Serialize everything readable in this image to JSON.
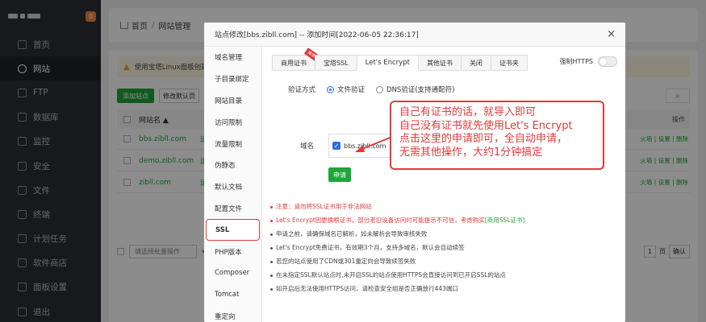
{
  "sidebar": {
    "badge": "0",
    "items": [
      {
        "label": "首页",
        "icon": "home-icon"
      },
      {
        "label": "网站",
        "icon": "globe-icon",
        "active": true
      },
      {
        "label": "FTP",
        "icon": "ftp-icon"
      },
      {
        "label": "数据库",
        "icon": "database-icon"
      },
      {
        "label": "监控",
        "icon": "monitor-icon"
      },
      {
        "label": "安全",
        "icon": "shield-icon"
      },
      {
        "label": "文件",
        "icon": "folder-icon"
      },
      {
        "label": "终端",
        "icon": "terminal-icon"
      },
      {
        "label": "计划任务",
        "icon": "calendar-icon"
      },
      {
        "label": "软件商店",
        "icon": "grid-icon"
      },
      {
        "label": "面板设置",
        "icon": "settings-icon"
      },
      {
        "label": "退出",
        "icon": "logout-icon"
      }
    ]
  },
  "breadcrumb": {
    "home": "首页",
    "sep": "/",
    "current": "网站管理"
  },
  "page": {
    "warning": "使用宝塔Linux面板创建",
    "add_site": "添加站点",
    "modify_default": "修改默认页",
    "col_site": "网站名 ▲",
    "col_status": "状",
    "col_ops": "操作",
    "rows": [
      {
        "name": "bbs.zibll.com",
        "status": "运",
        "ops": "火墙 | 设置 | 删除"
      },
      {
        "name": "demo.zibll.com",
        "status": "运",
        "ops": "火墙 | 设置 | 删除"
      },
      {
        "name": "zibll.com",
        "status": "运",
        "ops": "火墙 | 设置 | 删除"
      }
    ],
    "bulk_placeholder": "请选择批量操作",
    "pager_num": "1",
    "pager_page": "页",
    "pager_confirm": "确认"
  },
  "modal": {
    "title": "站点修改[bbs.zibll.com] -- 添加时间[2022-06-05 22:36:17]",
    "close": "×",
    "menu": [
      "域名管理",
      "子目录绑定",
      "网站目录",
      "访问限制",
      "流量限制",
      "伪静态",
      "默认文档",
      "配置文件",
      "SSL",
      "PHP版本",
      "Composer",
      "Tomcat",
      "重定向"
    ],
    "active_menu": "SSL",
    "tabs": [
      "商用证书",
      "宝塔SSL",
      "Let's Encrypt",
      "其他证书",
      "关闭",
      "证书夹"
    ],
    "active_tab": "Let's Encrypt",
    "ribbon": "推荐",
    "force_https": "强制HTTPS",
    "verify_label": "验证方式",
    "verify_file": "文件验证",
    "verify_dns": "DNS验证(支持通配符)",
    "domain_label": "域名",
    "domain_value": "bbs.zibll.com",
    "apply_button": "申请",
    "notes": [
      {
        "text": "注意：请勿将SSL证书用于非法网站",
        "red": true
      },
      {
        "text": "Let's Encrypt因更换根证书，部分老旧设备访问时可能提示不可信，考虑购买",
        "link": "[商用SSL证书]",
        "red": true
      },
      {
        "text": "申请之前，请确保域名已解析，如未解析会导致审核失败"
      },
      {
        "text": "Let's Encrypt免费证书，有效期3个月，支持多域名，默认会自动续签"
      },
      {
        "text": "若您的站点使用了CDN或301重定向会导致续签失败"
      },
      {
        "text": "在未指定SSL默认站点时,未开启SSL的站点使用HTTPS会直接访问到已开启SSL的站点"
      },
      {
        "text": "如开启后无法使用HTTPS访问，请检查安全组是否正确放行443端口"
      }
    ]
  },
  "annotation": {
    "lines": [
      "自己有证书的话，就导入即可",
      "自己没有证书就先使用Let's Encrypt",
      "点击这里的申请即可，全自动申请，",
      "无需其他操作，大约1分钟搞定"
    ]
  },
  "colors": {
    "accent_green": "#20a53a",
    "annotation_red": "#e23a3a",
    "sidebar_bg": "#2b2f33"
  }
}
